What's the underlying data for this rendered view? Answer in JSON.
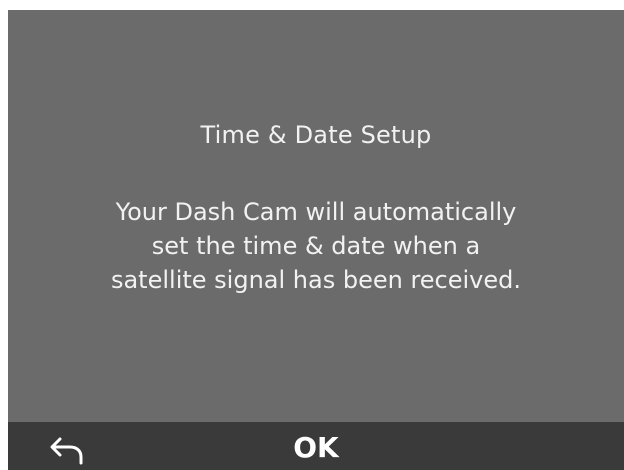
{
  "dialog": {
    "title": "Time & Date Setup",
    "message_lines": [
      "Your Dash Cam will automatically",
      "set the time & date when a",
      "satellite signal has been received."
    ]
  },
  "bottom_bar": {
    "back_icon": "back-arrow-icon",
    "ok_label": "OK"
  },
  "colors": {
    "screen_background": "#6b6b6b",
    "bottom_bar_background": "#3a3a3a",
    "text": "#f2f2f2"
  }
}
